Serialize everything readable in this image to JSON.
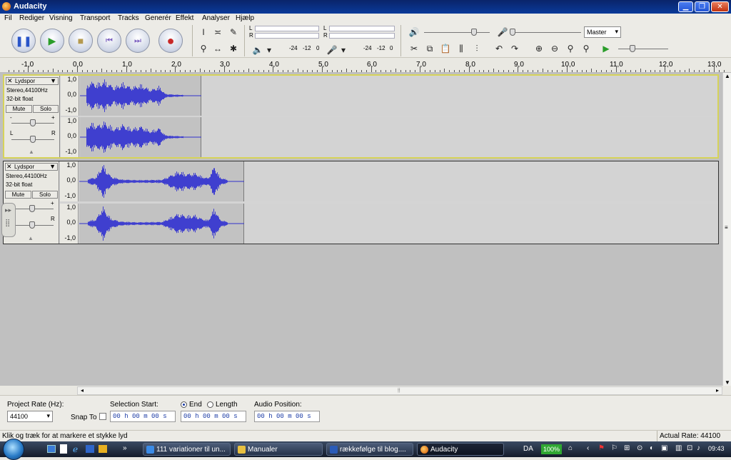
{
  "window": {
    "title": "Audacity"
  },
  "menu": [
    "Fil",
    "Rediger",
    "Visning",
    "Transport",
    "Tracks",
    "Generér",
    "Effekt",
    "Analyser",
    "Hjælp"
  ],
  "toolbar": {
    "meter_l": "L",
    "meter_r": "R",
    "meter_scale": [
      "-24",
      "-12",
      "0"
    ],
    "mixer_source": "Master"
  },
  "ruler": {
    "labels": [
      "-1,0",
      "0,0",
      "1,0",
      "2,0",
      "3,0",
      "4,0",
      "5,0",
      "6,0",
      "7,0",
      "8,0",
      "9,0",
      "10,0",
      "11,0",
      "12,0",
      "13,0"
    ]
  },
  "tracks": [
    {
      "name": "Lydspor",
      "info1": "Stereo,44100Hz",
      "info2": "32-bit float",
      "mute": "Mute",
      "solo": "Solo",
      "gain_minus": "-",
      "gain_plus": "+",
      "pan_l": "L",
      "pan_r": "R",
      "scale": [
        "1,0",
        "0,0",
        "-1,0"
      ],
      "selected": true,
      "clip_end_seconds": 2.5
    },
    {
      "name": "Lydspor",
      "info1": "Stereo,44100Hz",
      "info2": "32-bit float",
      "mute": "Mute",
      "solo": "Solo",
      "gain_minus": "-",
      "gain_plus": "+",
      "pan_l": "L",
      "pan_r": "R",
      "scale": [
        "1,0",
        "0,0",
        "-1,0"
      ],
      "selected": false,
      "clip_end_seconds": 3.4
    }
  ],
  "selection_bar": {
    "project_rate_label": "Project Rate (Hz):",
    "project_rate": "44100",
    "snap_to": "Snap To",
    "selection_start_label": "Selection Start:",
    "end_label": "End",
    "length_label": "Length",
    "audio_position_label": "Audio Position:",
    "time_value": "00 h 00 m 00 s"
  },
  "status": {
    "hint": "Klik og træk for at markere et stykke lyd",
    "actual_rate": "Actual Rate: 44100"
  },
  "taskbar": {
    "items": [
      "111 variationer til un...",
      "Manualer",
      "rækkefølge til blog....",
      "Audacity"
    ],
    "lang": "DA",
    "battery": "100%",
    "clock": "09:43"
  }
}
